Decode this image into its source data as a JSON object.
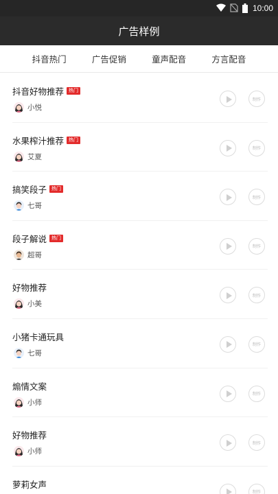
{
  "status_bar": {
    "time": "10:00",
    "icons": [
      "wifi-icon",
      "no-sim-icon",
      "battery-icon"
    ]
  },
  "header": {
    "title": "广告样例"
  },
  "tabs": [
    {
      "label": "抖音热门"
    },
    {
      "label": "广告促销"
    },
    {
      "label": "童声配音"
    },
    {
      "label": "方言配音"
    }
  ],
  "hot_label": "热门",
  "make_label": "制作",
  "items": [
    {
      "title": "抖音好物推荐",
      "hot": true,
      "author": "小悦",
      "avatar": "female"
    },
    {
      "title": "水果榨汁推荐",
      "hot": true,
      "author": "艾夏",
      "avatar": "female"
    },
    {
      "title": "搞笑段子",
      "hot": true,
      "author": "七哥",
      "avatar": "male"
    },
    {
      "title": "段子解说",
      "hot": true,
      "author": "超哥",
      "avatar": "male-dark"
    },
    {
      "title": "好物推荐",
      "hot": false,
      "author": "小美",
      "avatar": "female"
    },
    {
      "title": "小猪卡通玩具",
      "hot": false,
      "author": "七哥",
      "avatar": "male"
    },
    {
      "title": "煽情文案",
      "hot": false,
      "author": "小师",
      "avatar": "female"
    },
    {
      "title": "好物推荐",
      "hot": false,
      "author": "小师",
      "avatar": "female"
    },
    {
      "title": "萝莉女声",
      "hot": false,
      "author": "",
      "avatar": ""
    }
  ],
  "colors": {
    "header_bg": "#2b2b2b",
    "status_bg": "#262626",
    "hot_badge": "#e32b2b"
  }
}
